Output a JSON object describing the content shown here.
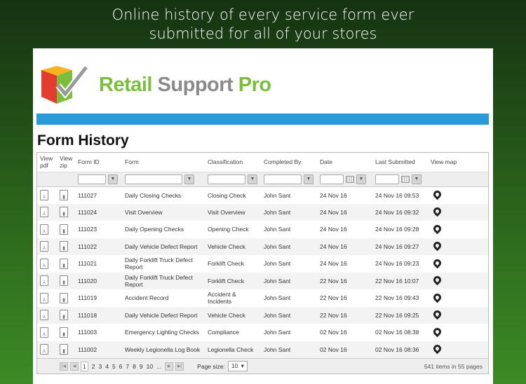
{
  "headline": [
    "Online history of every service form ever",
    "submitted for all of your stores"
  ],
  "logo": {
    "word1": "Retail",
    "word2": "Support",
    "word3": "Pro"
  },
  "page_title": "Form History",
  "columns": [
    "View pdf",
    "View zip",
    "Form ID",
    "Form",
    "Classification",
    "Completed By",
    "Date",
    "Last Submitted",
    "View map"
  ],
  "rows": [
    {
      "id": "111027",
      "form": "Daily Closing Checks",
      "class": "Closing Check",
      "by": "John Sant",
      "date": "24 Nov 16",
      "last": "24 Nov 16 09:53"
    },
    {
      "id": "111024",
      "form": "Visit Overview",
      "class": "Visit Overview",
      "by": "John Sant",
      "date": "24 Nov 16",
      "last": "24 Nov 16 09:32"
    },
    {
      "id": "111023",
      "form": "Daily Opening Checks",
      "class": "Opening Check",
      "by": "John Sant",
      "date": "24 Nov 16",
      "last": "24 Nov 16 09:28"
    },
    {
      "id": "111022",
      "form": "Daily Vehicle Defect Report",
      "class": "Vehicle Check",
      "by": "John Sant",
      "date": "24 Nov 16",
      "last": "24 Nov 16 09:27"
    },
    {
      "id": "111021",
      "form": "Daily Forklift Truck Defect Report",
      "class": "Forklift Check",
      "by": "John Sant",
      "date": "24 Nov 16",
      "last": "24 Nov 16 09:23"
    },
    {
      "id": "111020",
      "form": "Daily Forklift Truck Defect Report",
      "class": "Forklift Check",
      "by": "John Sant",
      "date": "22 Nov 16",
      "last": "22 Nov 16 10:07"
    },
    {
      "id": "111019",
      "form": "Accident Record",
      "class": "Accident & Incidents",
      "by": "John Sant",
      "date": "22 Nov 16",
      "last": "22 Nov 16 09:43"
    },
    {
      "id": "111018",
      "form": "Daily Vehicle Defect Report",
      "class": "Vehicle Check",
      "by": "John Sant",
      "date": "22 Nov 16",
      "last": "22 Nov 16 09:25"
    },
    {
      "id": "111003",
      "form": "Emergency Lighting Checks",
      "class": "Compliance",
      "by": "John Sant",
      "date": "02 Nov 16",
      "last": "02 Nov 16 08:38"
    },
    {
      "id": "111002",
      "form": "Weekly Legionella Log Book",
      "class": "Legionella Check",
      "by": "John Sant",
      "date": "02 Nov 16",
      "last": "02 Nov 16 08:36"
    }
  ],
  "pager": {
    "pages": [
      "1",
      "2",
      "3",
      "4",
      "5",
      "6",
      "7",
      "8",
      "9",
      "10",
      "..."
    ],
    "page_size_label": "Page size:",
    "page_size": "10",
    "info": "541 items in 55 pages"
  }
}
